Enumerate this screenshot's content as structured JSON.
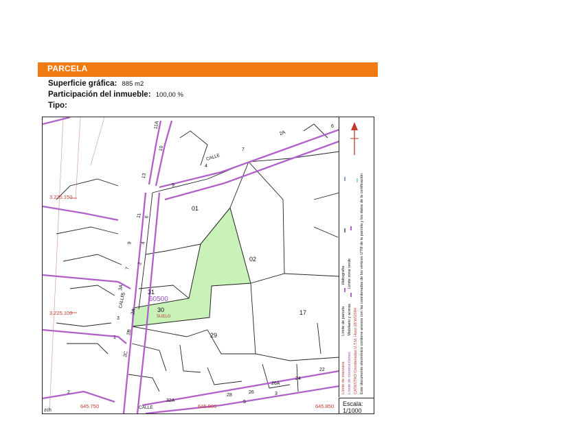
{
  "section": {
    "title": "PARCELA"
  },
  "info": {
    "superficie_label": "Superficie gráfica:",
    "superficie_value": "885 m2",
    "participacion_label": "Participación del inmueble:",
    "participacion_value": "100,00 %",
    "tipo_label": "Tipo:",
    "tipo_value": ""
  },
  "map": {
    "colors": {
      "highlight": "#c8f2b8",
      "block_line": "#b060c8",
      "parcel_line": "#222222",
      "coord": "#c0392b"
    },
    "parcel_numbers": [
      "01",
      "02",
      "17",
      "29",
      "30",
      "31"
    ],
    "block_number": "60500",
    "suelo_label": "SUELO",
    "coords_y": [
      "3.225.150",
      "3.225.100"
    ],
    "coords_x": [
      "645.750",
      "645.800",
      "645.850"
    ],
    "corner_label": "zch",
    "street_label": "CALLE",
    "house_numbers": [
      "2A",
      "6",
      "4",
      "7",
      "9",
      "10",
      "11A",
      "13",
      "11",
      "9",
      "6",
      "7",
      "4",
      "5",
      "2",
      "3A",
      "2A",
      "3",
      "2B",
      "2C",
      "1",
      "2",
      "32A",
      "28",
      "26",
      "26A",
      "24",
      "22",
      "3",
      "5"
    ]
  },
  "legend": {
    "items": [
      "Límite de manzana",
      "Límite de parcela",
      "Límite de construcciones",
      "Mobiliario y aceras",
      "Límite zona verde",
      "Hidrografía"
    ],
    "note": "Este documento electrónico contiene anexos con las coordenadas de los vértices UTM de la parcela y los datos de la certificación",
    "coord_note": "CATASTRO Coordenadas U.T.M. Huso 28 WGS84"
  },
  "scale": {
    "label": "Escala:",
    "value": "1/1000"
  }
}
